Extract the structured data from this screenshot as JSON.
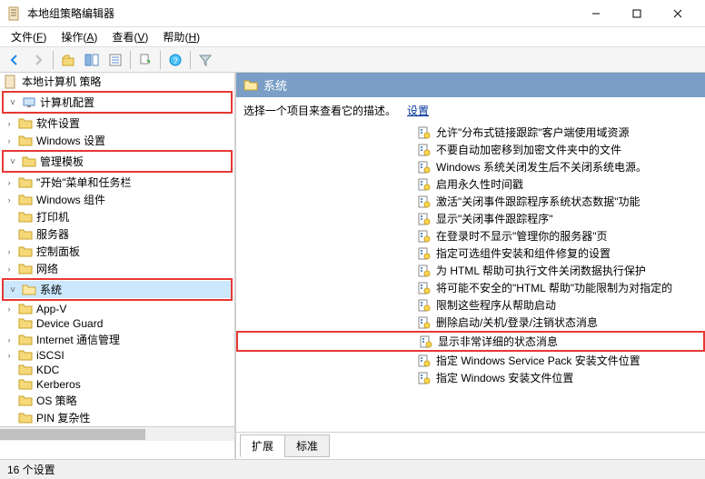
{
  "window": {
    "title": "本地组策略编辑器"
  },
  "menus": [
    {
      "label": "文件",
      "key": "F"
    },
    {
      "label": "操作",
      "key": "A"
    },
    {
      "label": "查看",
      "key": "V"
    },
    {
      "label": "帮助",
      "key": "H"
    }
  ],
  "tree": {
    "root": "本地计算机 策略",
    "computer_config": "计算机配置",
    "software": "软件设置",
    "windows_settings": "Windows 设置",
    "admin_templates": "管理模板",
    "start_menu": "\"开始\"菜单和任务栏",
    "windows_components": "Windows 组件",
    "printers": "打印机",
    "servers": "服务器",
    "control_panel": "控制面板",
    "network": "网络",
    "system": "系统",
    "app_v": "App-V",
    "device_guard": "Device Guard",
    "internet_mgmt": "Internet 通信管理",
    "iscsi": "iSCSI",
    "kdc": "KDC",
    "kerberos": "Kerberos",
    "os_policy": "OS 策略",
    "pin_complex": "PIN 复杂性"
  },
  "right": {
    "header": "系统",
    "description": "选择一个项目来查看它的描述。",
    "settings_label": "设置",
    "items": [
      "允许\"分布式链接跟踪\"客户端使用域资源",
      "不要自动加密移到加密文件夹中的文件",
      "Windows 系统关闭发生后不关闭系统电源。",
      "启用永久性时间戳",
      "激活\"关闭事件跟踪程序系统状态数据\"功能",
      "显示\"关闭事件跟踪程序\"",
      "在登录时不显示\"管理你的服务器\"页",
      "指定可选组件安装和组件修复的设置",
      "为 HTML 帮助可执行文件关闭数据执行保护",
      "将可能不安全的\"HTML 帮助\"功能限制为对指定的",
      "限制这些程序从帮助启动",
      "删除启动/关机/登录/注销状态消息",
      "显示非常详细的状态消息",
      "指定 Windows Service Pack 安装文件位置",
      "指定 Windows 安装文件位置"
    ],
    "highlighted_index": 12
  },
  "tabs": {
    "extended": "扩展",
    "standard": "标准"
  },
  "statusbar": {
    "text": "16 个设置"
  }
}
